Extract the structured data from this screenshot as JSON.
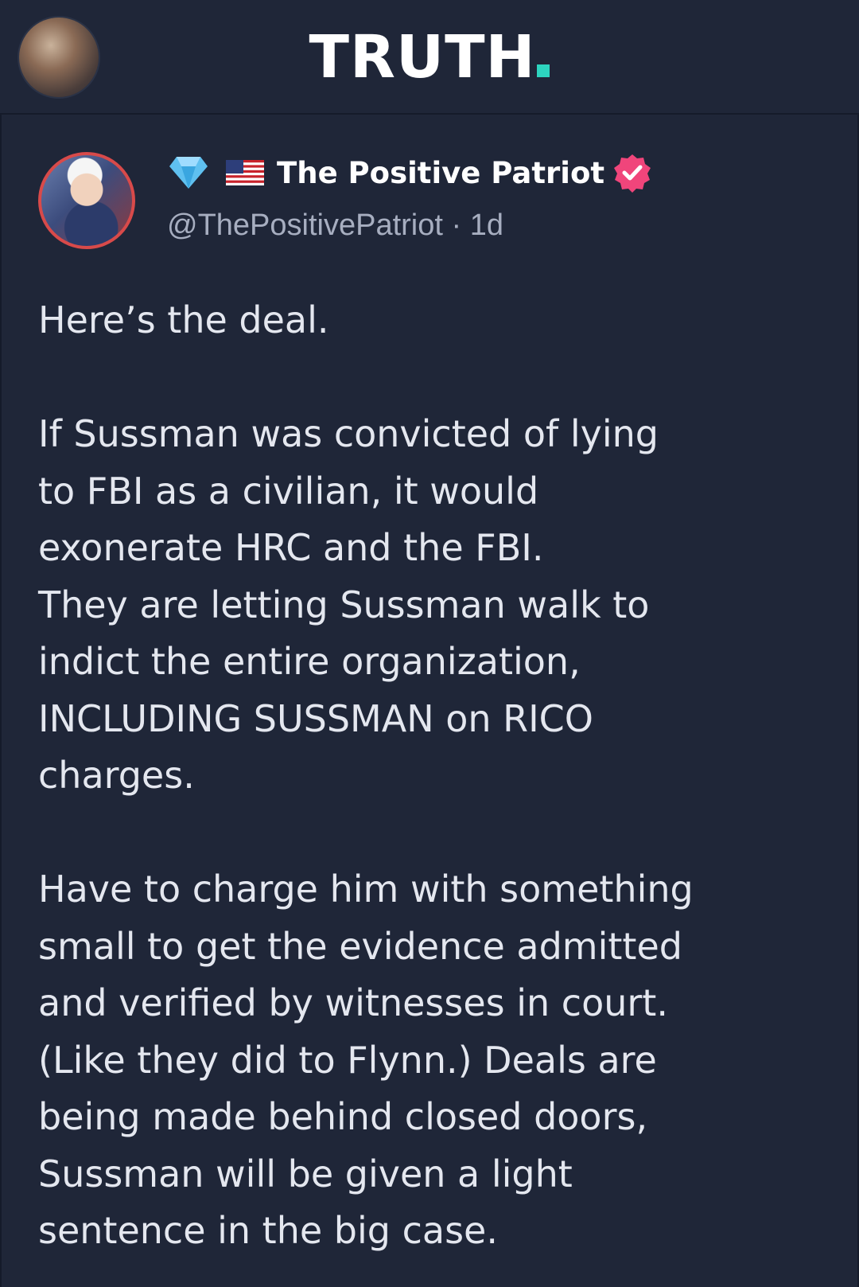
{
  "header": {
    "logo_text": "TRUTH",
    "logo_accent_color": "#2dd4bf"
  },
  "post": {
    "author": {
      "display_name": "The Positive Patriot",
      "handle": "@ThePositivePatriot",
      "time_separator": "·",
      "time_ago": "1d",
      "badges": [
        "diamond-icon",
        "us-flag-icon",
        "verified-icon"
      ],
      "verified_color": "#f0457b"
    },
    "paragraphs": [
      "Here’s the deal.",
      "If Sussman was convicted of lying\nto FBI as a civilian, it would\nexonerate HRC and the FBI.\nThey are letting Sussman walk to\nindict the entire organization,\nINCLUDING SUSSMAN on RICO\ncharges.",
      "Have to charge him with something\nsmall to get the evidence admitted\nand verified by witnesses in court.\n(Like they did to Flynn.) Deals are\nbeing made behind closed doors,\nSussman will be given a light\nsentence in the big case."
    ]
  },
  "colors": {
    "background": "#1f2638",
    "text": "#e4e7ef",
    "secondary_text": "#a7aec0"
  }
}
